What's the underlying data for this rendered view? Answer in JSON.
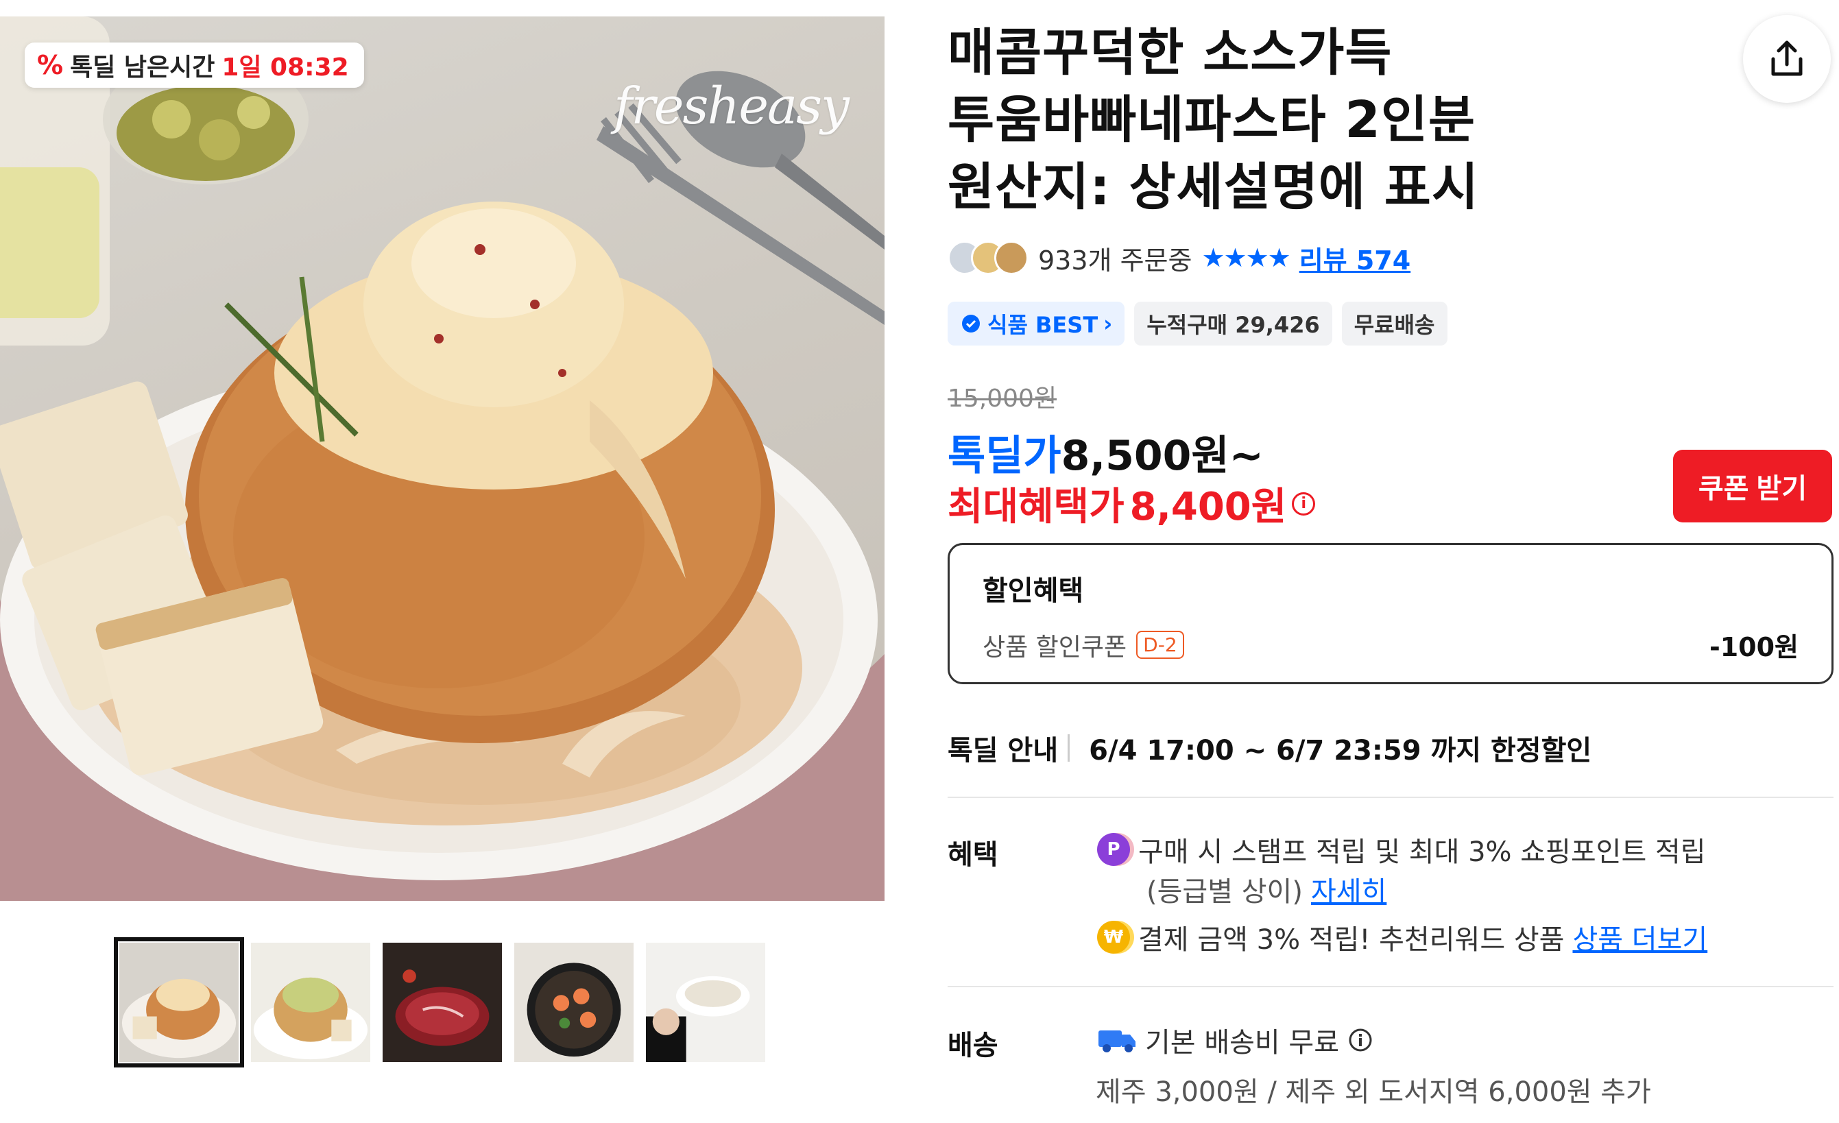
{
  "deal_badge": {
    "icon": "percent-icon",
    "label": "톡딜 남은시간",
    "time": "1일 08:32"
  },
  "brand": {
    "part1": "fresh",
    "part2": "easy"
  },
  "thumbnails": [
    {
      "name": "bread-bowl-cream-pasta",
      "active": true
    },
    {
      "name": "bread-bowl-green-pasta",
      "active": false
    },
    {
      "name": "raw-steak",
      "active": false
    },
    {
      "name": "shrimp-pan",
      "active": false
    },
    {
      "name": "chef-soup",
      "active": false
    }
  ],
  "product": {
    "title_lines": [
      "매콤꾸덕한 소스가득",
      "투움바빠네파스타 2인분",
      "원산지: 상세설명에 표시"
    ],
    "orders": "933개 주문중",
    "stars": "★★★★",
    "review_link": "리뷰 574",
    "chips": {
      "best": "식품 BEST",
      "cumulative": "누적구매 29,426",
      "shipping": "무료배송"
    },
    "original_price": "15,000원",
    "deal_label": "톡딜가",
    "deal_price": "8,500원~",
    "max_label": "최대혜택가",
    "max_price": "8,400원",
    "coupon_button": "쿠폰 받기"
  },
  "discount": {
    "heading": "할인혜택",
    "item": "상품 할인쿠폰",
    "dday": "D-2",
    "amount": "-100원"
  },
  "deal_info": {
    "label": "톡딜 안내",
    "text": "6/4 17:00 ~ 6/7 23:59 까지 한정할인"
  },
  "benefits": {
    "label": "혜택",
    "line1": "구매 시 스탬프 적립 및 최대 3% 쇼핑포인트 적립",
    "line2": "(등급별 상이)",
    "line2_link": "자세히",
    "line3": "결제 금액 3% 적립! 추천리워드 상품",
    "line3_link": "상품 더보기"
  },
  "shipping": {
    "label": "배송",
    "line1": "기본 배송비 무료",
    "line2": "제주 3,000원 / 제주 외 도서지역 6,000원 추가"
  },
  "colors": {
    "accent_blue": "#0066ff",
    "accent_red": "#ee1c25"
  }
}
